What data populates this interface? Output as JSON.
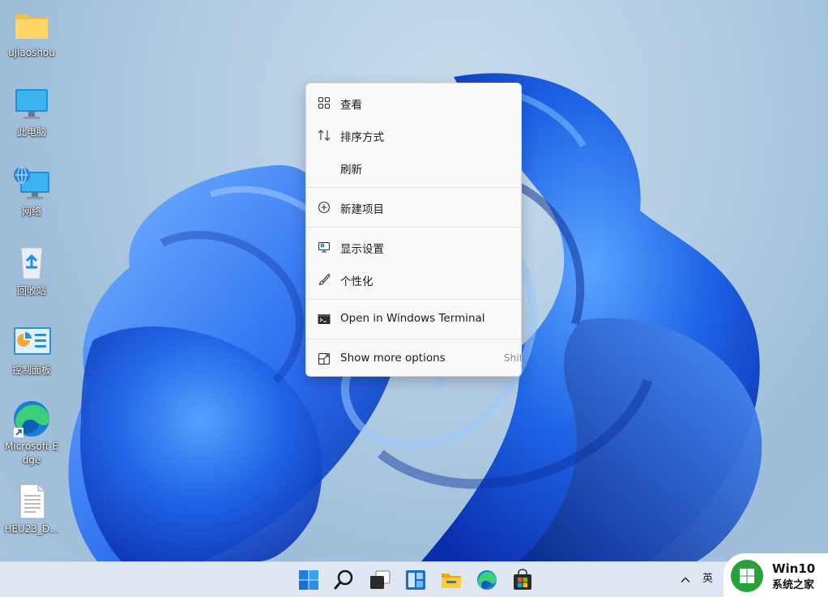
{
  "desktop": {
    "icons": [
      {
        "label": "ujiaoshou",
        "icon": "folder-icon"
      },
      {
        "label": "此电脑",
        "icon": "computer-icon"
      },
      {
        "label": "网络",
        "icon": "network-icon"
      },
      {
        "label": "回收站",
        "icon": "recycle-bin-icon"
      },
      {
        "label": "控制面板",
        "icon": "control-panel-icon"
      },
      {
        "label": "Microsoft Edge",
        "icon": "edge-icon"
      },
      {
        "label": "HEU23_D...",
        "icon": "document-icon"
      }
    ]
  },
  "context_menu": {
    "groups": [
      [
        {
          "label": "查看",
          "icon": "view-grid-icon"
        },
        {
          "label": "排序方式",
          "icon": "sort-icon"
        },
        {
          "label": "刷新",
          "icon": ""
        }
      ],
      [
        {
          "label": "新建项目",
          "icon": "new-item-plus-icon"
        }
      ],
      [
        {
          "label": "显示设置",
          "icon": "display-settings-icon"
        },
        {
          "label": "个性化",
          "icon": "personalize-brush-icon"
        }
      ],
      [
        {
          "label": "Open in Windows Terminal",
          "icon": "terminal-icon"
        }
      ],
      [
        {
          "label": "Show more options",
          "icon": "show-more-options-icon",
          "shortcut": "Shift"
        }
      ]
    ]
  },
  "taskbar": {
    "buttons": [
      "start-icon",
      "search-icon",
      "task-view-icon",
      "widgets-icon",
      "file-explorer-icon",
      "edge-icon",
      "store-icon"
    ],
    "ime_indicator": "英"
  },
  "watermark": {
    "title": "Win10",
    "subtitle": "系统之家"
  },
  "colors": {
    "accent": "#0067c0",
    "bloom_dark": "#0a3bc4",
    "bloom_light": "#3d8ef2",
    "menu_bg": "#f9f9f9",
    "taskbar_bg": "#dfe8f2"
  }
}
